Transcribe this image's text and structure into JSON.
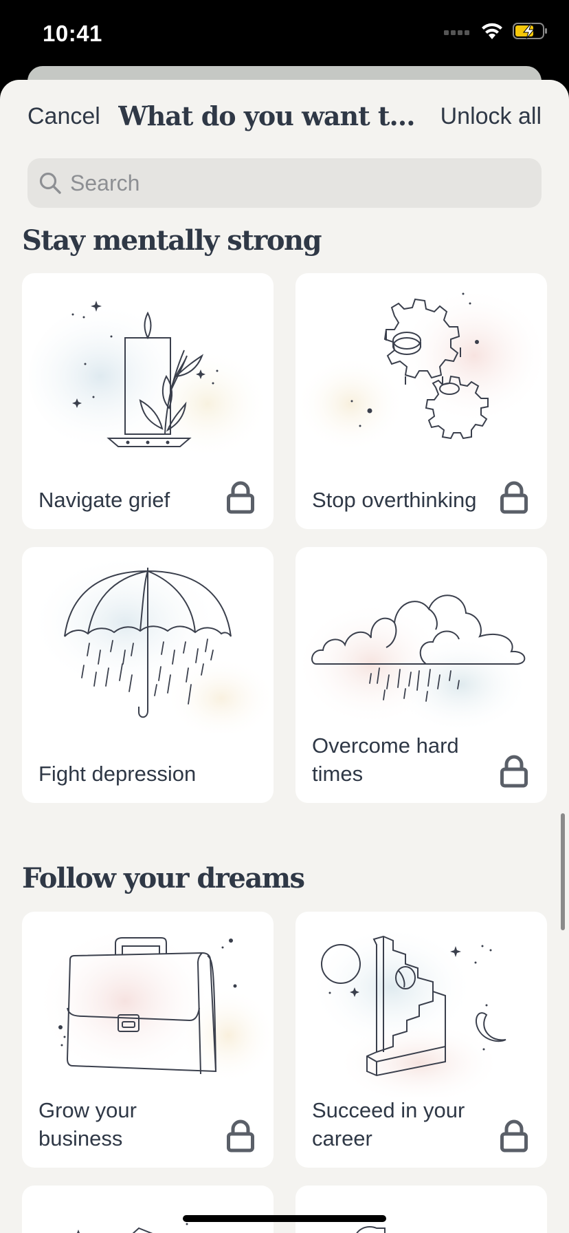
{
  "status_bar": {
    "time": "10:41"
  },
  "nav": {
    "cancel_label": "Cancel",
    "title": "What do you want to f...",
    "unlock_label": "Unlock all"
  },
  "search": {
    "placeholder": "Search"
  },
  "sections": [
    {
      "title": "Stay mentally strong",
      "cards": [
        {
          "label": "Navigate grief",
          "locked": true,
          "icon": "candle-icon"
        },
        {
          "label": "Stop overthinking",
          "locked": true,
          "icon": "gears-icon"
        },
        {
          "label": "Fight depression",
          "locked": false,
          "icon": "umbrella-icon"
        },
        {
          "label": "Overcome hard times",
          "locked": true,
          "icon": "rain-cloud-icon"
        }
      ]
    },
    {
      "title": "Follow your dreams",
      "cards": [
        {
          "label": "Grow your business",
          "locked": true,
          "icon": "briefcase-icon"
        },
        {
          "label": "Succeed in your career",
          "locked": true,
          "icon": "staircase-icon"
        }
      ]
    }
  ],
  "colors": {
    "text": "#2f3846",
    "sheet_bg": "#f4f3f0",
    "card_bg": "#ffffff",
    "lock": "#5a5f68"
  }
}
